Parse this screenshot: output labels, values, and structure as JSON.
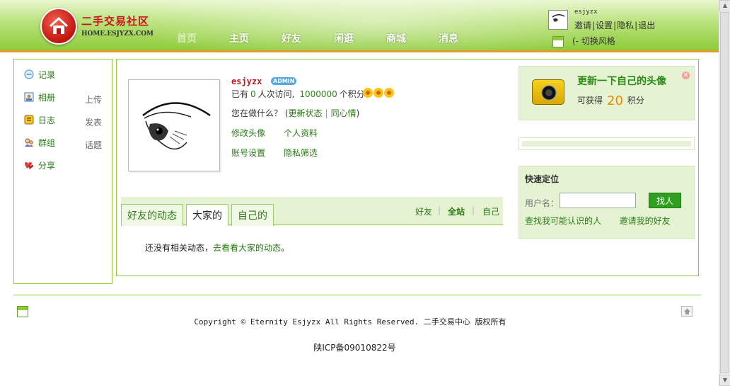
{
  "header": {
    "logo_brand": "二手交易社区",
    "logo_domain": "HOME.ESJYZX.COM",
    "nav": [
      {
        "label": "首页",
        "dim": true
      },
      {
        "label": "主页",
        "dim": false
      },
      {
        "label": "好友",
        "dim": false
      },
      {
        "label": "闲逛",
        "dim": false
      },
      {
        "label": "商城",
        "dim": false
      },
      {
        "label": "消息",
        "dim": false
      }
    ],
    "username": "esjyzx",
    "user_links": [
      "邀请",
      "设置",
      "隐私",
      "退出"
    ],
    "skin_label": "(- 切换风格"
  },
  "sidebar": {
    "items": [
      {
        "label": "记录",
        "icon": "record-icon",
        "extra": ""
      },
      {
        "label": "相册",
        "icon": "album-icon",
        "extra": "上传"
      },
      {
        "label": "日志",
        "icon": "blog-icon",
        "extra": "发表"
      },
      {
        "label": "群组",
        "icon": "group-icon",
        "extra": "话题"
      },
      {
        "label": "分享",
        "icon": "share-icon",
        "extra": ""
      }
    ]
  },
  "profile": {
    "name": "esjyzx",
    "badge": "ADMIN",
    "visits_prefix": "已有",
    "visits_count": "0",
    "visits_mid": "人次访问,",
    "points": "1000000",
    "points_suffix": "个积分",
    "doing_prompt": "您在做什么？",
    "update_status": "更新状态",
    "same_mood": "同心情",
    "links": [
      "修改头像",
      "个人资料",
      "账号设置",
      "隐私筛选"
    ]
  },
  "feed": {
    "tabs": [
      {
        "label": "好友的动态",
        "active": false
      },
      {
        "label": "大家的",
        "active": true
      },
      {
        "label": "自己的",
        "active": false
      }
    ],
    "filters": [
      {
        "label": "好友",
        "bold": false
      },
      {
        "label": "全站",
        "bold": true
      },
      {
        "label": "自己",
        "bold": false
      }
    ],
    "empty_text": "还没有相关动态，",
    "empty_link": "去看看大家的动态",
    "empty_end": "。"
  },
  "promo": {
    "title": "更新一下自己的头像",
    "sub_prefix": "可获得",
    "points": "20",
    "sub_suffix": "积分"
  },
  "quick_locate": {
    "title": "快速定位",
    "username_label": "用户名：",
    "username_value": "",
    "find_button": "找人",
    "link1": "查找我可能认识的人",
    "link2": "邀请我的好友"
  },
  "footer": {
    "copyright": "Copyright © Eternity Esjyzx All Rights Reserved. 二手交易中心 版权所有",
    "icp": "陕ICP备09010822号"
  }
}
